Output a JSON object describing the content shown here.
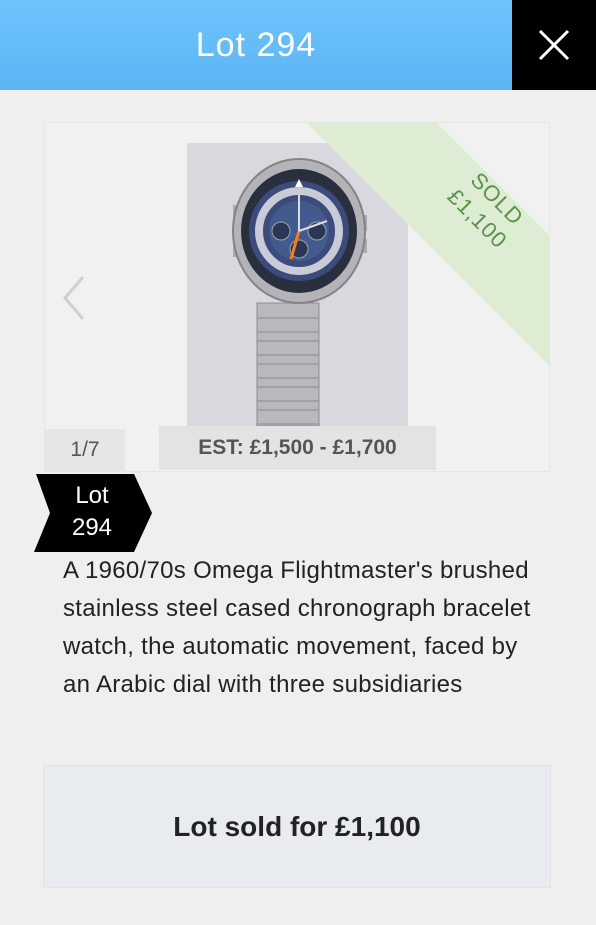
{
  "header": {
    "title": "Lot 294"
  },
  "close": {
    "icon": "close-icon"
  },
  "gallery": {
    "counter": "1/7",
    "estimate": "EST: £1,500 - £1,700",
    "sold_label": "SOLD",
    "sold_price": "£1,100",
    "ribbon_color": "#dcedd3"
  },
  "lot_tag": {
    "line1": "Lot",
    "line2": "294"
  },
  "description": "A 1960/70s Omega Flightmaster's brushed stainless steel cased chronograph bracelet watch, the automatic movement, faced by an Arabic dial with three subsidiaries",
  "sold_box": {
    "text": "Lot sold for £1,100"
  }
}
